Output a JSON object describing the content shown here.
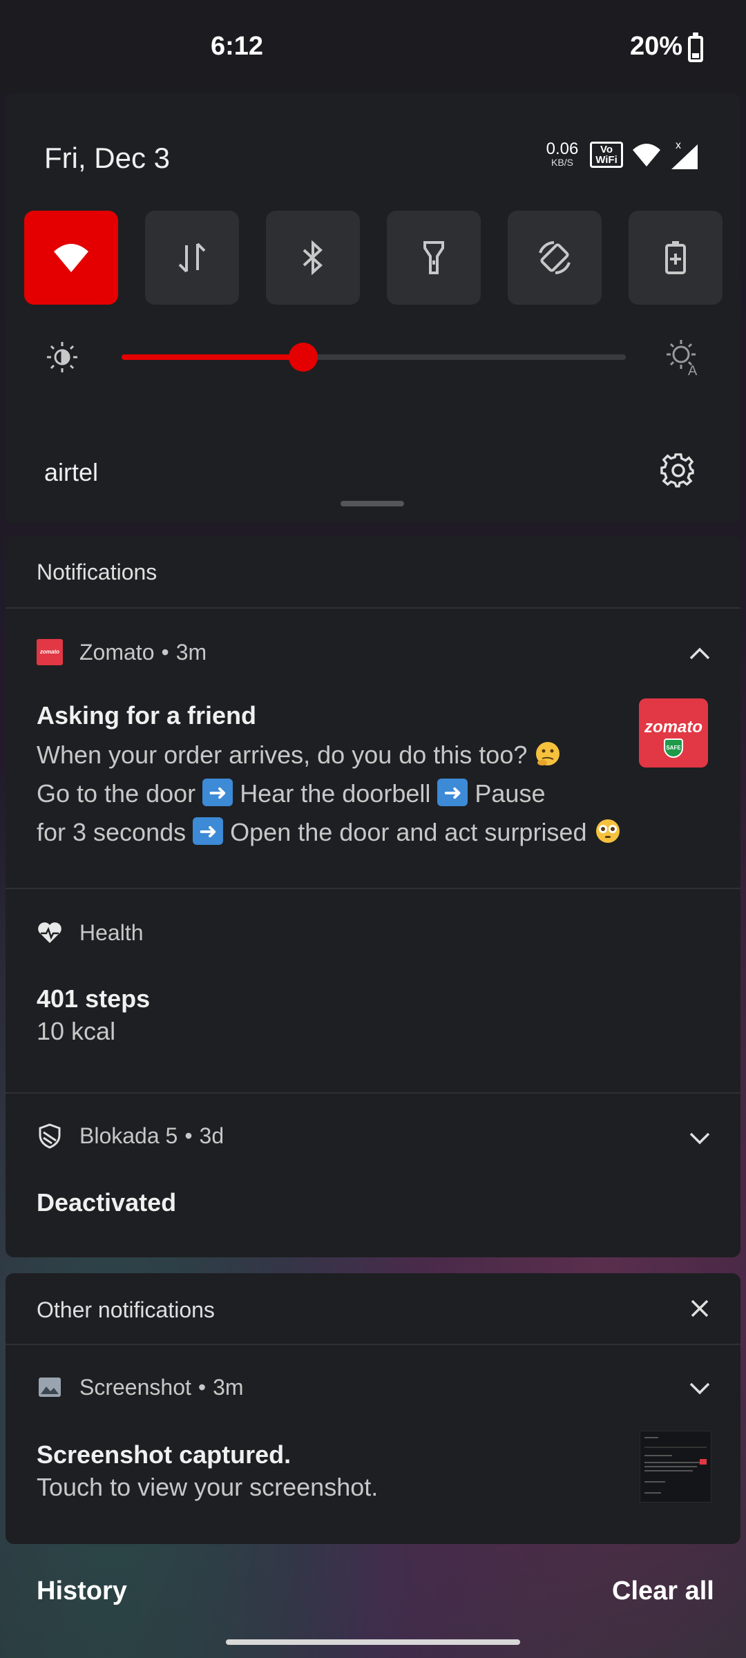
{
  "status_bar": {
    "time": "6:12",
    "battery": "20%"
  },
  "quick_settings": {
    "date": "Fri, Dec 3",
    "net_speed_value": "0.06",
    "net_speed_unit": "KB/S",
    "vowifi_label_1": "Vo",
    "vowifi_label_2": "WiFi",
    "signal_badge": "x",
    "tiles": [
      {
        "name": "Wi-Fi",
        "icon": "wifi-icon",
        "active": true
      },
      {
        "name": "Mobile data",
        "icon": "data-arrows-icon",
        "active": false
      },
      {
        "name": "Bluetooth",
        "icon": "bluetooth-icon",
        "active": false
      },
      {
        "name": "Flashlight",
        "icon": "flashlight-icon",
        "active": false
      },
      {
        "name": "Auto-rotate",
        "icon": "rotate-icon",
        "active": false
      },
      {
        "name": "Battery saver",
        "icon": "battery-saver-icon",
        "active": false
      }
    ],
    "brightness_level": 0.36,
    "accent_color": "#e40000",
    "carrier": "airtel"
  },
  "notifications": {
    "header": "Notifications",
    "zomato": {
      "app": "Zomato",
      "time": "3m",
      "title": "Asking for a friend",
      "line1": "When your order arrives, do you do this too?",
      "line2_a": "Go to the door",
      "line2_b": "Hear the doorbell",
      "line2_c": "Pause",
      "line3_a": "for 3 seconds",
      "line3_b": "Open the door and act surprised",
      "logo_text": "zomato",
      "logo_small": "zomato",
      "safe_badge": "SAFE"
    },
    "health": {
      "app": "Health",
      "title": "401 steps",
      "body": "10 kcal"
    },
    "blokada": {
      "app": "Blokada 5",
      "time": "3d",
      "title": "Deactivated"
    }
  },
  "other_notifications": {
    "header": "Other notifications",
    "screenshot": {
      "app": "Screenshot",
      "time": "3m",
      "title": "Screenshot captured.",
      "body": "Touch to view your screenshot."
    }
  },
  "footer": {
    "history": "History",
    "clear_all": "Clear all"
  },
  "separator": "•"
}
